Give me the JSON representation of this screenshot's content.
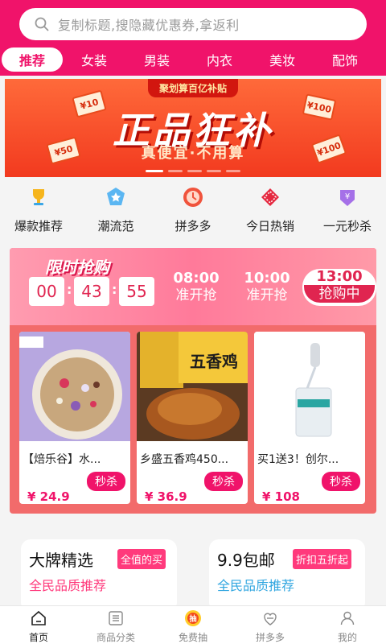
{
  "search": {
    "placeholder": "复制标题,搜隐藏优惠券,拿返利"
  },
  "tabs": [
    {
      "label": "推荐",
      "active": true
    },
    {
      "label": "女装"
    },
    {
      "label": "男装"
    },
    {
      "label": "内衣"
    },
    {
      "label": "美妆"
    },
    {
      "label": "配饰"
    }
  ],
  "banner": {
    "ribbon": "聚划算百亿补贴",
    "headline": "正品狂补",
    "sub": "真便宜·不用算",
    "coupons": [
      "¥10",
      "¥100",
      "¥50",
      "¥100"
    ]
  },
  "categories": [
    {
      "label": "爆款推荐",
      "icon": "trophy-icon"
    },
    {
      "label": "潮流范",
      "icon": "star-badge-icon"
    },
    {
      "label": "拼多多",
      "icon": "clock-icon"
    },
    {
      "label": "今日热销",
      "icon": "gift-icon"
    },
    {
      "label": "一元秒杀",
      "icon": "yen-bag-icon"
    }
  ],
  "flash_sale": {
    "title": "限时抢购",
    "countdown": [
      "00",
      "43",
      "55"
    ],
    "slots": [
      {
        "time": "08:00",
        "status": "准开抢"
      },
      {
        "time": "10:00",
        "status": "准开抢"
      },
      {
        "time": "13:00",
        "status": "抢购中",
        "current": true
      }
    ],
    "products": [
      {
        "name": "【焙乐谷】水...",
        "tag": "秒杀",
        "price": "¥ 24.9"
      },
      {
        "name": "乡盛五香鸡450...",
        "tag": "秒杀",
        "price": "¥ 36.9"
      },
      {
        "name": "买1送3！创尔...",
        "tag": "秒杀",
        "price": "¥ 108"
      }
    ]
  },
  "brand_cards": [
    {
      "title": "大牌精选",
      "badge": "全值的买",
      "subtitle": "全民品质推荐",
      "subtitle_color": "#ff3a7c"
    },
    {
      "title": "9.9包邮",
      "badge": "折扣五折起",
      "subtitle": "全民品质推荐",
      "subtitle_color": "#33a7e0"
    }
  ],
  "nav": [
    {
      "label": "首页",
      "icon": "home-icon",
      "active": true
    },
    {
      "label": "商品分类",
      "icon": "list-icon"
    },
    {
      "label": "免费抽",
      "icon": "lottery-icon"
    },
    {
      "label": "拼多多",
      "icon": "heart-icon"
    },
    {
      "label": "我的",
      "icon": "user-icon"
    }
  ],
  "colors": {
    "brand": "#f0136a",
    "price": "#f0136a"
  }
}
